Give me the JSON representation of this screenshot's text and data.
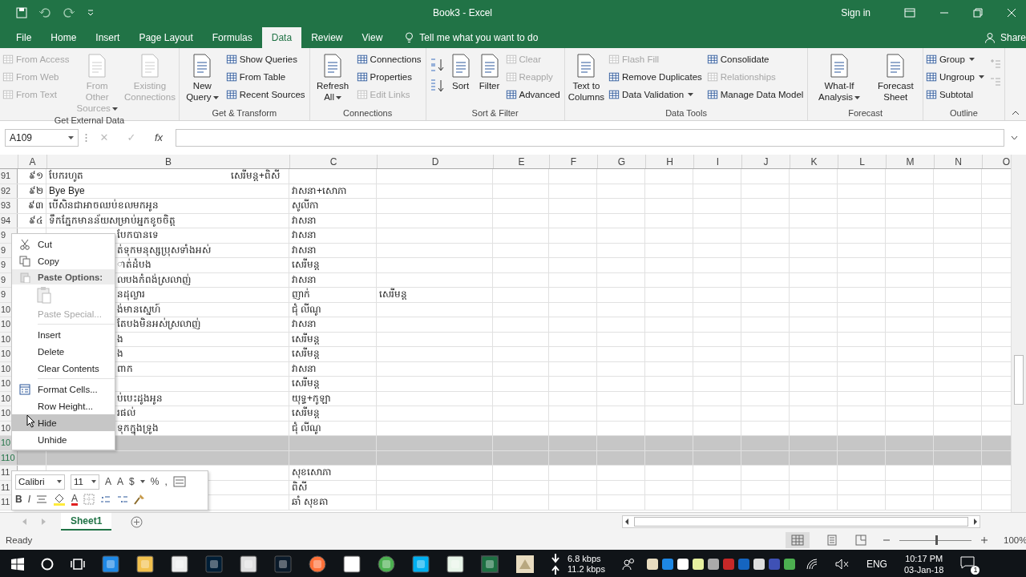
{
  "window": {
    "title": "Book3 - Excel",
    "sign_in": "Sign in"
  },
  "tabs": [
    {
      "label": "File",
      "selected": false
    },
    {
      "label": "Home",
      "selected": false
    },
    {
      "label": "Insert",
      "selected": false
    },
    {
      "label": "Page Layout",
      "selected": false
    },
    {
      "label": "Formulas",
      "selected": false
    },
    {
      "label": "Data",
      "selected": true
    },
    {
      "label": "Review",
      "selected": false
    },
    {
      "label": "View",
      "selected": false
    }
  ],
  "tell_me": {
    "placeholder": "Tell me what you want to do"
  },
  "share": "Share",
  "ribbon": [
    {
      "label": "Get External Data",
      "items": [
        {
          "kind": "stack",
          "buttons": [
            {
              "label": "From Access",
              "disabled": true,
              "dropdown": false
            },
            {
              "label": "From Web",
              "disabled": true,
              "dropdown": false
            },
            {
              "label": "From Text",
              "disabled": true,
              "dropdown": false
            }
          ]
        },
        {
          "kind": "large",
          "label": "From Other Sources",
          "disabled": true,
          "dropdown": true
        },
        {
          "kind": "large",
          "label": "Existing Connections",
          "disabled": true,
          "dropdown": false
        }
      ]
    },
    {
      "label": "Get & Transform",
      "items": [
        {
          "kind": "large",
          "label": "New Query",
          "disabled": false,
          "dropdown": true
        },
        {
          "kind": "stack",
          "buttons": [
            {
              "label": "Show Queries",
              "disabled": false,
              "dropdown": false
            },
            {
              "label": "From Table",
              "disabled": false,
              "dropdown": false
            },
            {
              "label": "Recent Sources",
              "disabled": false,
              "dropdown": false
            }
          ]
        }
      ]
    },
    {
      "label": "Connections",
      "items": [
        {
          "kind": "large",
          "label": "Refresh All",
          "disabled": false,
          "dropdown": true
        },
        {
          "kind": "stack",
          "buttons": [
            {
              "label": "Connections",
              "disabled": false,
              "dropdown": false
            },
            {
              "label": "Properties",
              "disabled": false,
              "dropdown": false
            },
            {
              "label": "Edit Links",
              "disabled": true,
              "dropdown": false
            }
          ]
        }
      ]
    },
    {
      "label": "Sort & Filter",
      "items": [
        {
          "kind": "sort-icons"
        },
        {
          "kind": "large",
          "label": "Sort",
          "disabled": false,
          "dropdown": false
        },
        {
          "kind": "large",
          "label": "Filter",
          "disabled": false,
          "dropdown": false
        },
        {
          "kind": "stack",
          "buttons": [
            {
              "label": "Clear",
              "disabled": true,
              "dropdown": false
            },
            {
              "label": "Reapply",
              "disabled": true,
              "dropdown": false
            },
            {
              "label": "Advanced",
              "disabled": false,
              "dropdown": false
            }
          ]
        }
      ]
    },
    {
      "label": "Data Tools",
      "items": [
        {
          "kind": "large",
          "label": "Text to Columns",
          "disabled": false,
          "dropdown": false
        },
        {
          "kind": "stack",
          "buttons": [
            {
              "label": "Flash Fill",
              "disabled": true,
              "dropdown": false
            },
            {
              "label": "Remove Duplicates",
              "disabled": false,
              "dropdown": false
            },
            {
              "label": "Data Validation",
              "disabled": false,
              "dropdown": true
            }
          ]
        },
        {
          "kind": "stack",
          "buttons": [
            {
              "label": "Consolidate",
              "disabled": false,
              "dropdown": false
            },
            {
              "label": "Relationships",
              "disabled": true,
              "dropdown": false
            },
            {
              "label": "Manage Data Model",
              "disabled": false,
              "dropdown": false
            }
          ]
        }
      ]
    },
    {
      "label": "Forecast",
      "items": [
        {
          "kind": "large",
          "label": "What-If Analysis",
          "disabled": false,
          "dropdown": true
        },
        {
          "kind": "large",
          "label": "Forecast Sheet",
          "disabled": false,
          "dropdown": false
        }
      ]
    },
    {
      "label": "Outline",
      "items": [
        {
          "kind": "stack",
          "buttons": [
            {
              "label": "Group",
              "disabled": false,
              "dropdown": true
            },
            {
              "label": "Ungroup",
              "disabled": false,
              "dropdown": true
            },
            {
              "label": "Subtotal",
              "disabled": false,
              "dropdown": false
            }
          ]
        },
        {
          "kind": "detail-icons"
        }
      ]
    }
  ],
  "formula_bar": {
    "name_box": "A109",
    "cancel": "✕",
    "enter": "✓",
    "fx": "fx"
  },
  "columns": [
    "A",
    "B",
    "C",
    "D",
    "E",
    "F",
    "G",
    "H",
    "I",
    "J",
    "K",
    "L",
    "M",
    "N",
    "O"
  ],
  "rows": [
    {
      "header": "91",
      "a": "៩១",
      "b": "បែករហូត",
      "b_right": "សេរីមន្ត+ពិសី",
      "c": "",
      "d": "",
      "selected": false
    },
    {
      "header": "92",
      "a": "៩២",
      "b": "Bye Bye",
      "c": "វាសនា+សោភា",
      "d": "",
      "selected": false
    },
    {
      "header": "93",
      "a": "៩៣",
      "b": "បើសិនជាអាចឈប់ខលមកអូន",
      "c": "សូលីកា",
      "d": "",
      "selected": false
    },
    {
      "header": "94",
      "a": "៩៤",
      "b": "ទឹកភ្នែកមានន័យសម្រាប់អ្នកខូចចិត្ត",
      "c": "វាសនា",
      "d": "",
      "selected": false
    },
    {
      "header": "9",
      "a": "",
      "b": "បែកបានទេ",
      "c": "វាសនា",
      "d": "",
      "selected": false
    },
    {
      "header": "9",
      "a": "",
      "b": "ត់ទុកមនុស្សប្រុសទាំងអស់",
      "c": "វាសនា",
      "d": "",
      "selected": false
    },
    {
      "header": "9",
      "a": "",
      "b": "ាត់ដំបង",
      "c": "សេរីមន្ត",
      "d": "",
      "selected": false
    },
    {
      "header": "9",
      "a": "",
      "b": "លបងកំពង់ស្រលាញ់",
      "c": "វាសនា",
      "d": "",
      "selected": false
    },
    {
      "header": "9",
      "a": "",
      "b": "នដុល្លារ",
      "c": "ញាក់",
      "d": "សេរីមន្ត",
      "selected": false
    },
    {
      "header": "10",
      "a": "",
      "b": "ង់មានស្នេហ៍",
      "c": "ជុំ លីណូ",
      "d": "",
      "selected": false
    },
    {
      "header": "10",
      "a": "",
      "b": "តែបងមិនអស់ស្រលាញ់",
      "c": "វាសនា",
      "d": "",
      "selected": false
    },
    {
      "header": "10",
      "a": "",
      "b": "ង",
      "c": "សេរីមន្ត",
      "d": "",
      "selected": false
    },
    {
      "header": "10",
      "a": "",
      "b": "ង",
      "c": "សេរីមន្ត",
      "d": "",
      "selected": false
    },
    {
      "header": "10",
      "a": "",
      "b": "ពាក",
      "c": "វាសនា",
      "d": "",
      "selected": false
    },
    {
      "header": "10",
      "a": "",
      "b": "",
      "c": "សេរីមន្ត",
      "d": "",
      "selected": false
    },
    {
      "header": "10",
      "a": "",
      "b": "ប់បេះដូងអូន",
      "c": "យុទ្ធ+កូឡា",
      "d": "",
      "selected": false
    },
    {
      "header": "10",
      "a": "",
      "b": "រផល់",
      "c": "សេរីមន្ត",
      "d": "",
      "selected": false
    },
    {
      "header": "10",
      "a": "",
      "b": "ទុកក្នុងទ្រូង",
      "c": "ជុំ លីណូ",
      "d": "",
      "selected": false
    },
    {
      "header": "10",
      "a": "",
      "b": "",
      "c": "",
      "d": "",
      "selected": true
    },
    {
      "header": "110",
      "a": "",
      "b": "",
      "c": "",
      "d": "",
      "selected": true
    },
    {
      "header": "11",
      "a": "",
      "b": "",
      "c": "សុខសោភា",
      "d": "",
      "selected": false
    },
    {
      "header": "11",
      "a": "",
      "b": "",
      "c": "ពិសី",
      "d": "",
      "selected": false
    },
    {
      "header": "11",
      "a": "",
      "b": "",
      "c": "ឆាំ សុខគា",
      "d": "",
      "selected": false
    }
  ],
  "context_menu": [
    {
      "kind": "item",
      "label": "Cut",
      "icon": true,
      "disabled": false,
      "selected": false
    },
    {
      "kind": "item",
      "label": "Copy",
      "icon": true,
      "disabled": false,
      "selected": false
    },
    {
      "kind": "header",
      "label": "Paste Options:",
      "icon": true
    },
    {
      "kind": "paste-icons"
    },
    {
      "kind": "item",
      "label": "Paste Special...",
      "icon": false,
      "disabled": true,
      "selected": false
    },
    {
      "kind": "separator"
    },
    {
      "kind": "item",
      "label": "Insert",
      "icon": false,
      "disabled": false,
      "selected": false
    },
    {
      "kind": "item",
      "label": "Delete",
      "icon": false,
      "disabled": false,
      "selected": false
    },
    {
      "kind": "item",
      "label": "Clear Contents",
      "icon": false,
      "disabled": false,
      "selected": false
    },
    {
      "kind": "separator"
    },
    {
      "kind": "item",
      "label": "Format Cells...",
      "icon": true,
      "disabled": false,
      "selected": false
    },
    {
      "kind": "item",
      "label": "Row Height...",
      "icon": false,
      "disabled": false,
      "selected": false
    },
    {
      "kind": "item",
      "label": "Hide",
      "icon": false,
      "disabled": false,
      "selected": true
    },
    {
      "kind": "item",
      "label": "Unhide",
      "icon": false,
      "disabled": false,
      "selected": false
    }
  ],
  "mini_toolbar": {
    "font": "Calibri",
    "size": "11",
    "grow": "A",
    "shrink": "A",
    "currency": "$",
    "percent": "%",
    "comma": ",",
    "bold": "B",
    "italic": "I",
    "font_color": "A"
  },
  "sheets": [
    {
      "label": "Sheet1",
      "selected": true
    }
  ],
  "status_bar": {
    "text": "Ready",
    "zoom": "100%",
    "zoom_slider": {
      "level": 0.5
    }
  },
  "taskbar": {
    "download": "6.8 kbps",
    "upload": "11.2 kbps",
    "language": "ENG",
    "time": "10:17 PM",
    "date": "03-Jan-18",
    "notifications": "1"
  }
}
